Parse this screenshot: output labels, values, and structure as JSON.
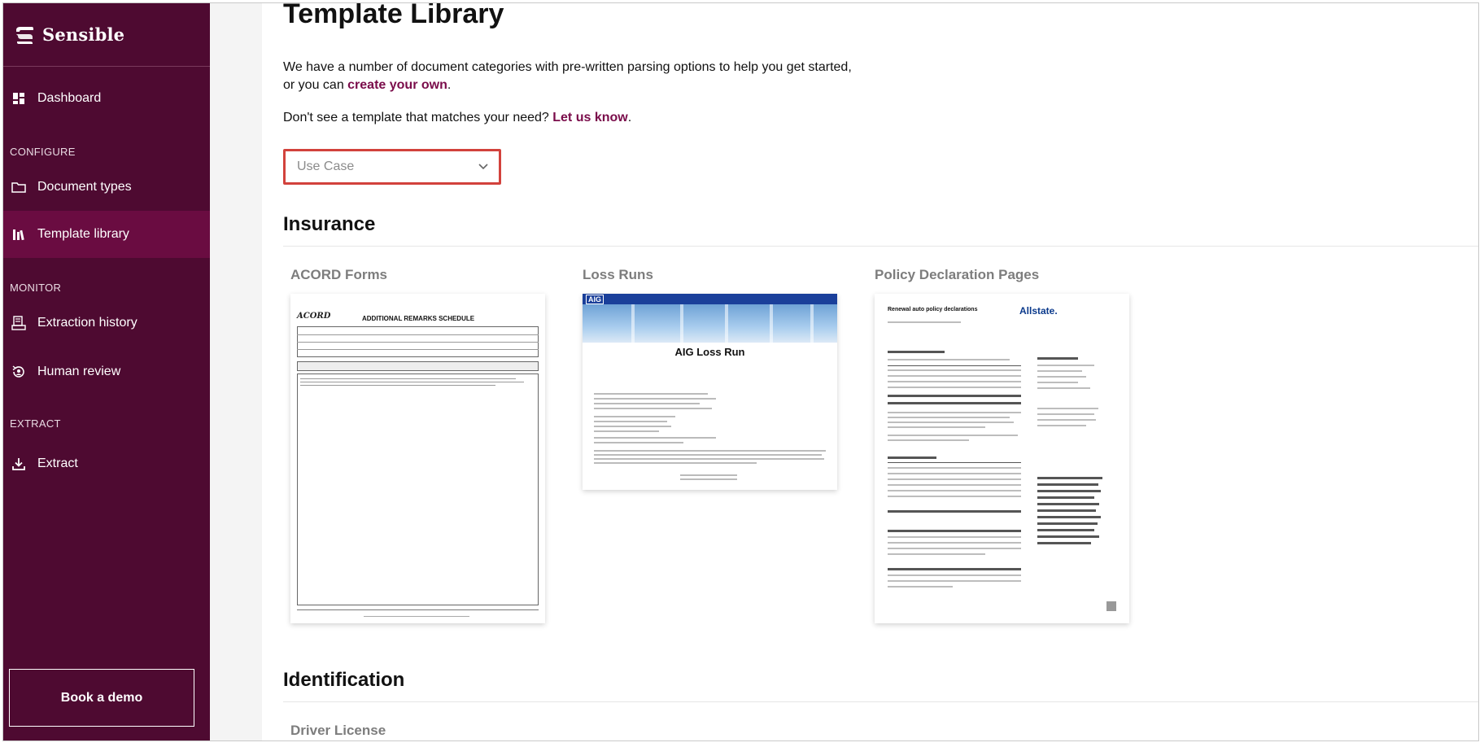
{
  "app": {
    "brand_name": "Sensible"
  },
  "sidebar": {
    "items": [
      {
        "label": "Dashboard",
        "icon": "dashboard-icon"
      },
      {
        "label": "Document types",
        "icon": "folder-icon"
      },
      {
        "label": "Template library",
        "icon": "library-icon",
        "active": true
      },
      {
        "label": "Extraction history",
        "icon": "history-icon"
      },
      {
        "label": "Human review",
        "icon": "review-icon"
      },
      {
        "label": "Extract",
        "icon": "download-icon"
      }
    ],
    "sections": {
      "configure": "CONFIGURE",
      "monitor": "MONITOR",
      "extract": "EXTRACT"
    },
    "demo_button": "Book a demo"
  },
  "main": {
    "title": "Template Library",
    "intro_text_1": "We have a number of document categories with pre-written parsing options to help you get started,",
    "intro_text_2": "or you can ",
    "intro_link": "create your own",
    "intro_end": ".",
    "ask_text": "Don't see a template that matches your need? ",
    "ask_link": "Let us know",
    "ask_end": ".",
    "use_case_placeholder": "Use Case",
    "sections": [
      {
        "title": "Insurance",
        "cards": [
          {
            "title": "ACORD Forms",
            "thumb_heading": "ADDITIONAL REMARKS SCHEDULE",
            "thumb_logo": "ACORD"
          },
          {
            "title": "Loss Runs",
            "thumb_heading": "AIG Loss Run",
            "thumb_brand": "AIG"
          },
          {
            "title": "Policy Declaration Pages",
            "thumb_heading": "Renewal auto policy declarations",
            "thumb_brand": "Allstate."
          }
        ]
      },
      {
        "title": "Identification",
        "cards": [
          {
            "title": "Driver License"
          }
        ]
      }
    ]
  },
  "colors": {
    "sidebar_bg": "#4e0a31",
    "sidebar_active": "#6a0c41",
    "link": "#7a0c4a",
    "highlight_border": "#d2423c"
  }
}
